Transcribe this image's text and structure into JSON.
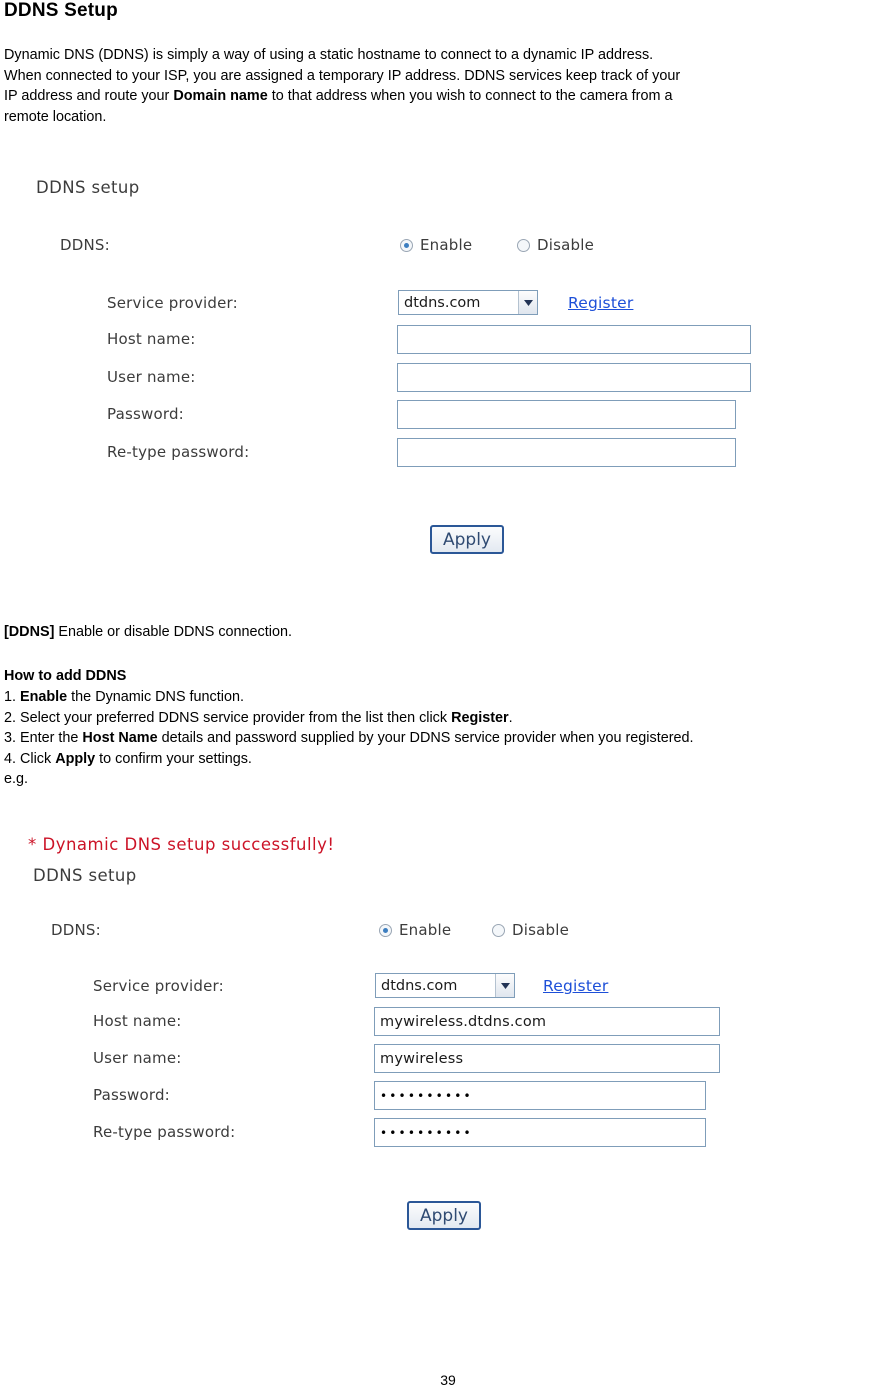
{
  "document": {
    "title": "DDNS Setup",
    "intro_lines": [
      "Dynamic DNS (DDNS) is simply a way of using a static hostname to connect to a dynamic IP address.",
      "When connected to your ISP, you are assigned a temporary IP address. DDNS services keep track of your",
      "IP address and route your ",
      "Domain name",
      " to that address when you wish to connect to the camera from a",
      "remote location."
    ],
    "page_number": "39"
  },
  "form_empty": {
    "panel_title": "DDNS setup",
    "ddns_label": "DDNS:",
    "radio_enable": "Enable",
    "radio_disable": "Disable",
    "ddns_selected": "enable",
    "service_provider_label": "Service provider:",
    "service_provider_value": "dtdns.com",
    "service_provider_options": [
      "dtdns.com"
    ],
    "register_link": "Register",
    "host_name_label": "Host name:",
    "host_name_value": "",
    "host_name_placeholder": "",
    "user_name_label": "User name:",
    "user_name_value": "",
    "password_label": "Password:",
    "password_value": "",
    "retype_label": "Re-type password:",
    "retype_value": "",
    "apply_label": "Apply"
  },
  "notes": {
    "ddns_tag": "[DDNS]",
    "ddns_desc": " Enable or disable DDNS connection.",
    "how_to_title": "How to add DDNS",
    "steps": [
      {
        "num": "1. ",
        "bold1": "Enable",
        "rest1": " the Dynamic DNS function.",
        "bold2": "",
        "rest2": ""
      },
      {
        "num": "2. ",
        "bold1": "",
        "rest1": "Select your preferred DDNS service provider from the list then click ",
        "bold2": "Register",
        "rest2": "."
      },
      {
        "num": "3. ",
        "bold1": "",
        "rest1": "Enter the ",
        "bold2": "Host Name",
        "rest2": " details and password supplied by your DDNS service provider when you registered."
      },
      {
        "num": "4. ",
        "bold1": "",
        "rest1": "Click ",
        "bold2": "Apply",
        "rest2": " to confirm your settings."
      }
    ],
    "eg": "e.g."
  },
  "form_filled": {
    "success_message": "* Dynamic DNS setup successfully!",
    "panel_title": "DDNS setup",
    "ddns_label": "DDNS:",
    "radio_enable": "Enable",
    "radio_disable": "Disable",
    "ddns_selected": "enable",
    "service_provider_label": "Service provider:",
    "service_provider_value": "dtdns.com",
    "service_provider_options": [
      "dtdns.com"
    ],
    "register_link": "Register",
    "host_name_label": "Host name:",
    "host_name_value": "mywireless.dtdns.com",
    "user_name_label": "User name:",
    "user_name_value": "mywireless",
    "password_label": "Password:",
    "password_value": "••••••••••",
    "retype_label": "Re-type password:",
    "retype_value": "••••••••••",
    "apply_label": "Apply"
  },
  "colors": {
    "link": "#1d4fd8",
    "success": "#cc1327",
    "panel_text": "#3c3c3c",
    "input_border": "#7f9db9",
    "button_border": "#2b5797"
  }
}
